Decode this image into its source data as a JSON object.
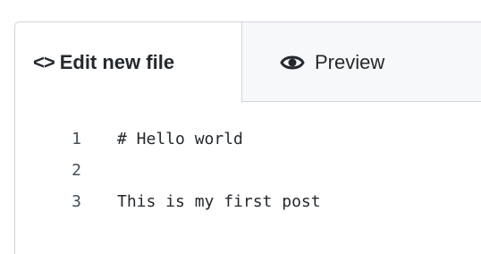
{
  "tabs": {
    "edit": {
      "icon": "code-icon",
      "icon_glyph": "<>",
      "label": "Edit new file",
      "active": true
    },
    "preview": {
      "icon": "eye-icon",
      "label": "Preview",
      "active": false
    }
  },
  "editor": {
    "lines": [
      {
        "number": "1",
        "text": "# Hello world"
      },
      {
        "number": "2",
        "text": ""
      },
      {
        "number": "3",
        "text": "This is my first post"
      }
    ]
  },
  "colors": {
    "border": "#d1d5da",
    "tab_bar_bg": "#f6f8fa",
    "text": "#24292e"
  }
}
